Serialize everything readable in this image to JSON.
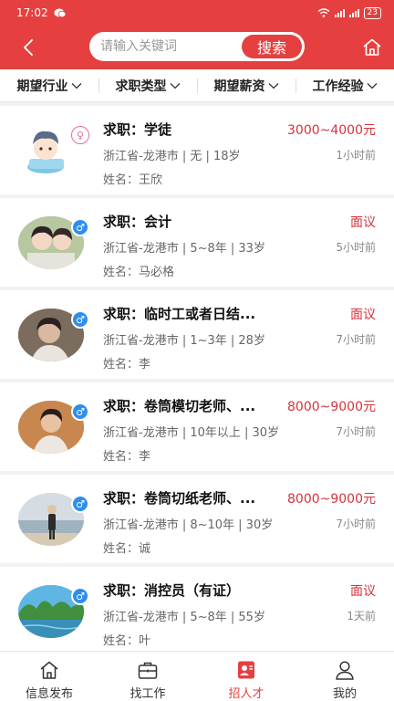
{
  "status_bar": {
    "time": "17:02",
    "battery": "23"
  },
  "search": {
    "placeholder": "请输入关键词",
    "button_label": "搜索"
  },
  "filters": [
    "期望行业",
    "求职类型",
    "期望薪资",
    "工作经验"
  ],
  "candidates": [
    {
      "title": "求职：学徒",
      "salary": "3000~4000元",
      "info": "浙江省-龙港市 | 无 | 18岁",
      "time": "1小时前",
      "name": "姓名：王欣",
      "gender": "female"
    },
    {
      "title": "求职：会计",
      "salary": "面议",
      "info": "浙江省-龙港市 | 5~8年 | 33岁",
      "time": "5小时前",
      "name": "姓名：马必格",
      "gender": "male"
    },
    {
      "title": "求职：临时工或者日结...",
      "salary": "面议",
      "info": "浙江省-龙港市 | 1~3年 | 28岁",
      "time": "7小时前",
      "name": "姓名：李",
      "gender": "male"
    },
    {
      "title": "求职：卷筒模切老师、...",
      "salary": "8000~9000元",
      "info": "浙江省-龙港市 | 10年以上 | 30岁",
      "time": "7小时前",
      "name": "姓名：李",
      "gender": "male"
    },
    {
      "title": "求职：卷筒切纸老师、...",
      "salary": "8000~9000元",
      "info": "浙江省-龙港市 | 8~10年 | 30岁",
      "time": "7小时前",
      "name": "姓名：诚",
      "gender": "male"
    },
    {
      "title": "求职：消控员（有证）",
      "salary": "面议",
      "info": "浙江省-龙港市 | 5~8年 | 55岁",
      "time": "1天前",
      "name": "姓名：叶",
      "gender": "male"
    }
  ],
  "tabs": [
    {
      "label": "信息发布",
      "icon": "home-icon",
      "active": false
    },
    {
      "label": "找工作",
      "icon": "briefcase-icon",
      "active": false
    },
    {
      "label": "招人才",
      "icon": "recruit-icon",
      "active": true
    },
    {
      "label": "我的",
      "icon": "person-icon",
      "active": false
    }
  ],
  "colors": {
    "brand": "#e5403f",
    "salary": "#d8323a",
    "male_badge": "#2e8ef0",
    "female_badge": "#e46b9c"
  }
}
